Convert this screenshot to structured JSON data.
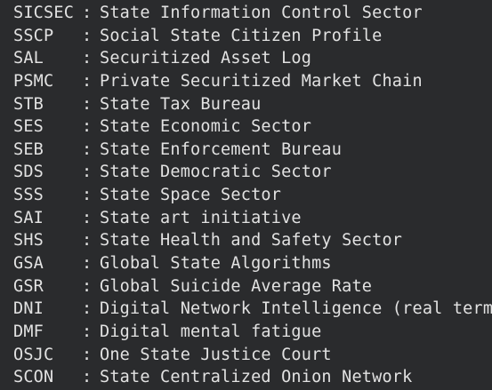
{
  "glossary": {
    "separator": ":",
    "rows": [
      {
        "abbr": "SICSEC",
        "desc": "State Information Control Sector"
      },
      {
        "abbr": "SSCP",
        "desc": "Social State Citizen Profile"
      },
      {
        "abbr": "SAL",
        "desc": "Securitized Asset Log"
      },
      {
        "abbr": "PSMC",
        "desc": "Private Securitized Market Chain"
      },
      {
        "abbr": "STB",
        "desc": "State Tax Bureau"
      },
      {
        "abbr": "SES",
        "desc": "State Economic Sector"
      },
      {
        "abbr": "SEB",
        "desc": "State Enforcement Bureau"
      },
      {
        "abbr": "SDS",
        "desc": "State Democratic Sector"
      },
      {
        "abbr": "SSS",
        "desc": "State Space Sector"
      },
      {
        "abbr": "SAI",
        "desc": "State art initiative"
      },
      {
        "abbr": "SHS",
        "desc": "State Health and Safety Sector"
      },
      {
        "abbr": "GSA",
        "desc": "Global State Algorithms"
      },
      {
        "abbr": "GSR",
        "desc": "Global Suicide Average Rate"
      },
      {
        "abbr": "DNI",
        "desc": "Digital Network Intelligence (real term)"
      },
      {
        "abbr": "DMF",
        "desc": "Digital mental fatigue"
      },
      {
        "abbr": "OSJC",
        "desc": "One State Justice Court"
      },
      {
        "abbr": "SCON",
        "desc": "State Centralized Onion Network"
      }
    ]
  }
}
